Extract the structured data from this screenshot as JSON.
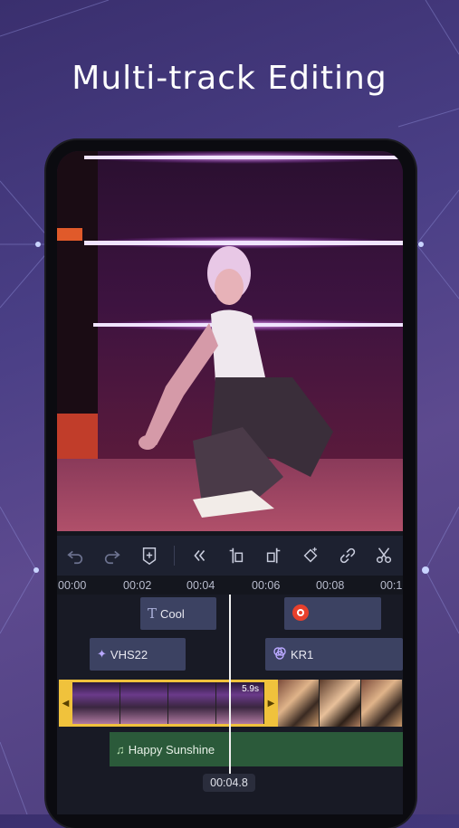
{
  "headline": "Multi-track Editing",
  "toolbar": {
    "tools": [
      "undo-icon",
      "redo-icon",
      "add-keyframe-icon",
      "collapse-icon",
      "split-start-icon",
      "split-end-icon",
      "keyframe-icon",
      "link-icon",
      "cut-icon"
    ]
  },
  "ruler": {
    "ticks": [
      "00:00",
      "00:02",
      "00:04",
      "00:06",
      "00:08",
      "00:1"
    ]
  },
  "tracks": {
    "text_clip": "Cool",
    "effect_clip": "VHS22",
    "filter_clip": "KR1",
    "video_duration": "5.9s",
    "audio_clip": "Happy Sunshine"
  },
  "playhead_time": "00:04.8",
  "colors": {
    "selection": "#f0c23c",
    "audio_track": "#2b5a3a",
    "clip": "#3c4262",
    "neon": "#e6b8ff"
  }
}
